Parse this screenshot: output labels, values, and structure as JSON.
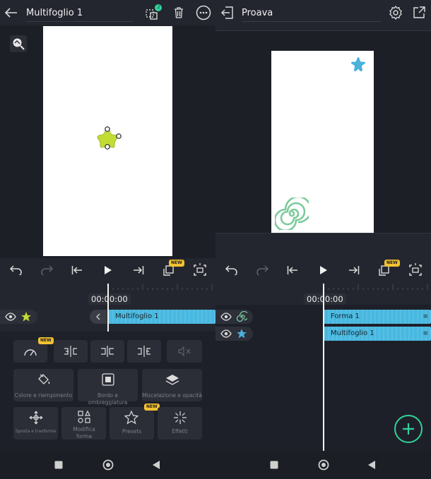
{
  "left": {
    "title": "Multifoglio 1",
    "layers_badge": "2",
    "timecode": "00:00:00",
    "clip_label": "Multifoglio 1",
    "new_badge": "NEW",
    "props": [
      {
        "label": "",
        "icon": "speedometer-icon",
        "badge": "NEW"
      },
      {
        "label": "",
        "icon": "split-left-icon"
      },
      {
        "label": "",
        "icon": "split-center-icon"
      },
      {
        "label": "",
        "icon": "split-right-icon"
      },
      {
        "label": "",
        "icon": "mute-icon"
      }
    ],
    "props_row2": [
      {
        "label": "Colore e riempimento",
        "icon": "paint-bucket-icon"
      },
      {
        "label": "Bordo e ombreggiatura",
        "icon": "border-shadow-icon"
      },
      {
        "label": "Miscelazione e opacità",
        "icon": "layers-blend-icon"
      }
    ],
    "props_row3": [
      {
        "label": "Sposta e trasforma",
        "icon": "move-icon"
      },
      {
        "label": "Modifica forma",
        "icon": "edit-shape-icon"
      },
      {
        "label": "Presets",
        "icon": "star-outline-icon",
        "badge": "NEW"
      },
      {
        "label": "Effetti",
        "icon": "sparkle-icon"
      }
    ]
  },
  "right": {
    "title": "Proava",
    "timecode": "00:00:00",
    "new_badge": "NEW",
    "tracks": [
      {
        "clip_label": "Forma 1",
        "icon": "spiral-icon"
      },
      {
        "clip_label": "Multifoglio 1",
        "icon": "star-icon"
      }
    ]
  },
  "colors": {
    "accent": "#48b8e0",
    "shape_green": "#c3dc34",
    "spiral_green": "#7cc99a",
    "star_blue": "#4ab1dc",
    "fab": "#2fd39a",
    "badge": "#f2c230"
  }
}
